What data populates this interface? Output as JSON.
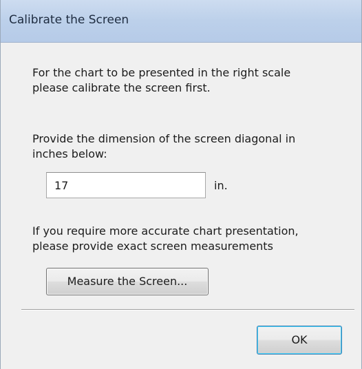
{
  "window": {
    "title": "Calibrate the Screen"
  },
  "intro": {
    "line1": "For the chart to be presented in the right scale",
    "line2": "please calibrate the screen first."
  },
  "diagonal": {
    "line1": "Provide the dimension of the screen diagonal in",
    "line2": "inches below:",
    "value": "17",
    "unit": "in."
  },
  "accuracy": {
    "line1": "If you require more accurate chart presentation,",
    "line2": "please provide exact screen measurements"
  },
  "buttons": {
    "measure_label": "Measure the Screen...",
    "ok_label": "OK"
  }
}
